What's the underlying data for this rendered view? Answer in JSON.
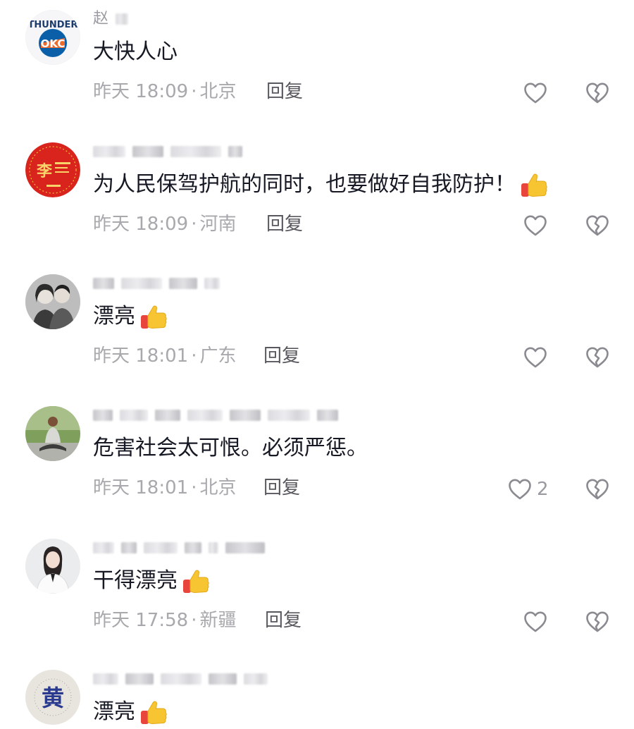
{
  "colors": {
    "text_primary": "#161823",
    "text_secondary": "#a8a8ad",
    "reply": "#58585f",
    "icon": "#9a9aa0"
  },
  "comments": [
    {
      "username_visible": "赵",
      "content": "大快人心",
      "has_thumb": false,
      "time": "昨天 18:09",
      "location": "北京",
      "reply_label": "回复",
      "like_count": "",
      "avatar": "thunder-okc-logo"
    },
    {
      "username_visible": "",
      "content": "为人民保驾护航的同时，也要做好自我防护！",
      "has_thumb": true,
      "time": "昨天 18:09",
      "location": "河南",
      "reply_label": "回复",
      "like_count": "",
      "avatar": "red-li-character"
    },
    {
      "username_visible": "",
      "content": "漂亮",
      "has_thumb": true,
      "time": "昨天 18:01",
      "location": "广东",
      "reply_label": "回复",
      "like_count": "",
      "avatar": "couple-photo"
    },
    {
      "username_visible": "",
      "content": "危害社会太可恨。必须严惩。",
      "has_thumb": false,
      "time": "昨天 18:01",
      "location": "北京",
      "reply_label": "回复",
      "like_count": "2",
      "avatar": "man-sitting-photo"
    },
    {
      "username_visible": "",
      "content": "干得漂亮",
      "has_thumb": true,
      "time": "昨天 17:58",
      "location": "新疆",
      "reply_label": "回复",
      "like_count": "",
      "avatar": "woman-portrait"
    },
    {
      "username_visible": "",
      "content": "漂亮",
      "has_thumb": true,
      "time": "",
      "location": "",
      "reply_label": "",
      "like_count": "",
      "avatar": "huang-character"
    }
  ],
  "avatar_text": {
    "thunder_top": "THUNDER",
    "thunder_mid": "OKC",
    "li_char": "李",
    "huang_char": "黄"
  }
}
